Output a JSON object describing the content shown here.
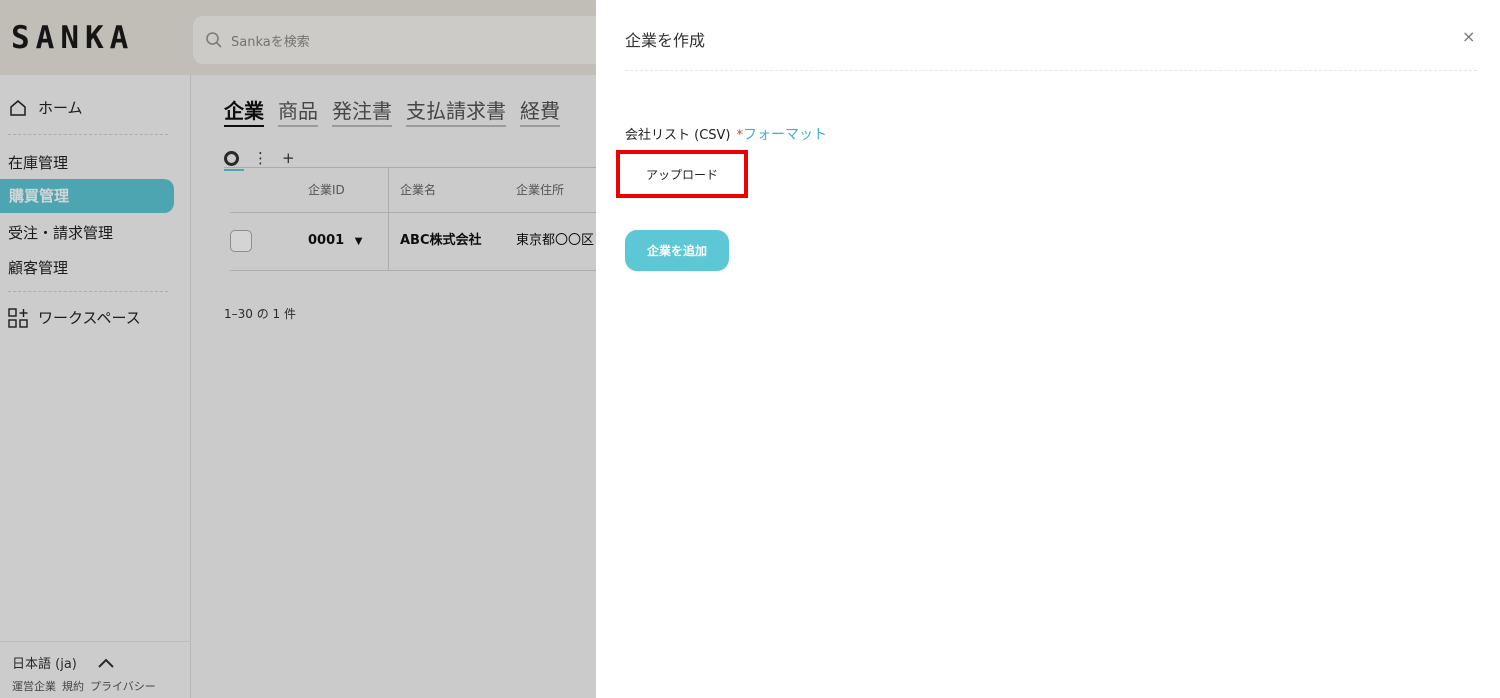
{
  "app": {
    "logo": "SANKA"
  },
  "search": {
    "placeholder": "Sankaを検索"
  },
  "sidebar": {
    "home": "ホーム",
    "items": [
      {
        "label": "在庫管理"
      },
      {
        "label": "購買管理"
      },
      {
        "label": "受注・請求管理"
      },
      {
        "label": "顧客管理"
      }
    ],
    "workspace": "ワークスペース",
    "language": "日本語 (ja)",
    "footer_links": [
      "運営企業",
      "規約",
      "プライバシー"
    ]
  },
  "main": {
    "tabs": [
      "企業",
      "商品",
      "発注書",
      "支払請求書",
      "経費"
    ],
    "add_view": "+",
    "table": {
      "headers": [
        "企業ID",
        "企業名",
        "企業住所"
      ],
      "rows": [
        {
          "id": "0001",
          "name": "ABC株式会社",
          "address": "東京都〇〇区"
        }
      ]
    },
    "count": "1–30 の 1 件"
  },
  "drawer": {
    "title": "企業を作成",
    "close": "×",
    "field_label": "会社リスト (CSV)",
    "required_mark": "*",
    "format_link": "フォーマット",
    "upload_button": "アップロード",
    "submit_button": "企業を追加"
  },
  "colors": {
    "accent": "#5ec7d6",
    "highlight": "#ee0000",
    "link": "#39b3cf"
  }
}
